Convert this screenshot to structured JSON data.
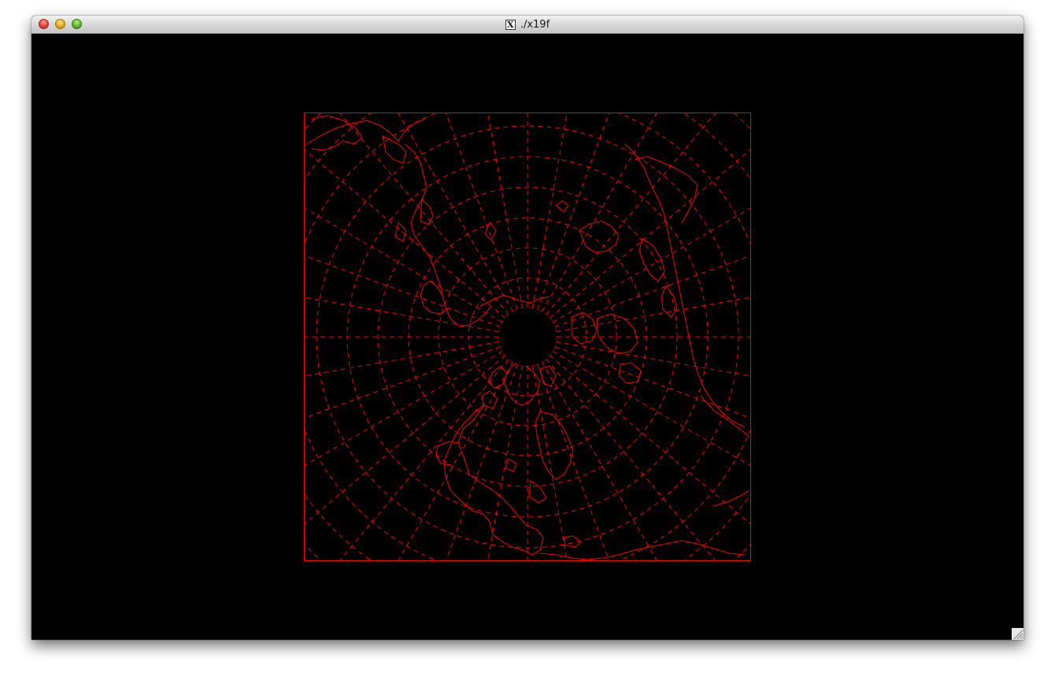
{
  "window": {
    "title": "./x19f",
    "title_icon": "X"
  },
  "plot": {
    "type": "polar-stereographic-map",
    "line_color": "#ff0000",
    "background": "#000000",
    "grid": "dashed"
  },
  "icons": {
    "close": "close-icon",
    "minimize": "minimize-icon",
    "zoom": "zoom-icon",
    "resize": "resize-grip-icon",
    "app": "x11-icon"
  }
}
